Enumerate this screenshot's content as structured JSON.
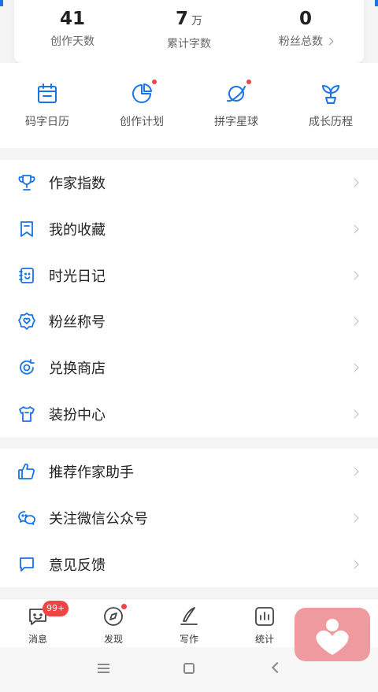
{
  "stats": [
    {
      "value": "41",
      "unit": "",
      "label": "创作天数"
    },
    {
      "value": "7",
      "unit": "万",
      "label": "累计字数"
    },
    {
      "value": "0",
      "unit": "",
      "label": "粉丝总数"
    }
  ],
  "quick_actions": [
    {
      "label": "码字日历",
      "icon": "calendar-icon",
      "dot": false
    },
    {
      "label": "创作计划",
      "icon": "pie-chart-icon",
      "dot": true
    },
    {
      "label": "拼字星球",
      "icon": "planet-icon",
      "dot": true
    },
    {
      "label": "成长历程",
      "icon": "sprout-icon",
      "dot": false
    }
  ],
  "menu_group_1": [
    {
      "label": "作家指数",
      "icon": "trophy-icon"
    },
    {
      "label": "我的收藏",
      "icon": "bookmark-icon"
    },
    {
      "label": "时光日记",
      "icon": "diary-icon"
    },
    {
      "label": "粉丝称号",
      "icon": "badge-icon"
    },
    {
      "label": "兑换商店",
      "icon": "exchange-icon"
    },
    {
      "label": "装扮中心",
      "icon": "tshirt-icon"
    }
  ],
  "menu_group_2": [
    {
      "label": "推荐作家助手",
      "icon": "thumbs-up-icon"
    },
    {
      "label": "关注微信公众号",
      "icon": "wechat-icon"
    },
    {
      "label": "意见反馈",
      "icon": "feedback-icon"
    }
  ],
  "tabbar": [
    {
      "label": "消息",
      "icon": "message-icon",
      "badge": "99+"
    },
    {
      "label": "发现",
      "icon": "compass-icon",
      "badge": ""
    },
    {
      "label": "写作",
      "icon": "pen-icon",
      "badge": ""
    },
    {
      "label": "统计",
      "icon": "stats-icon",
      "badge": ""
    }
  ],
  "colors": {
    "accent": "#1a73e8",
    "badge": "#ef4444",
    "float_badge": "#ee9a9e"
  }
}
